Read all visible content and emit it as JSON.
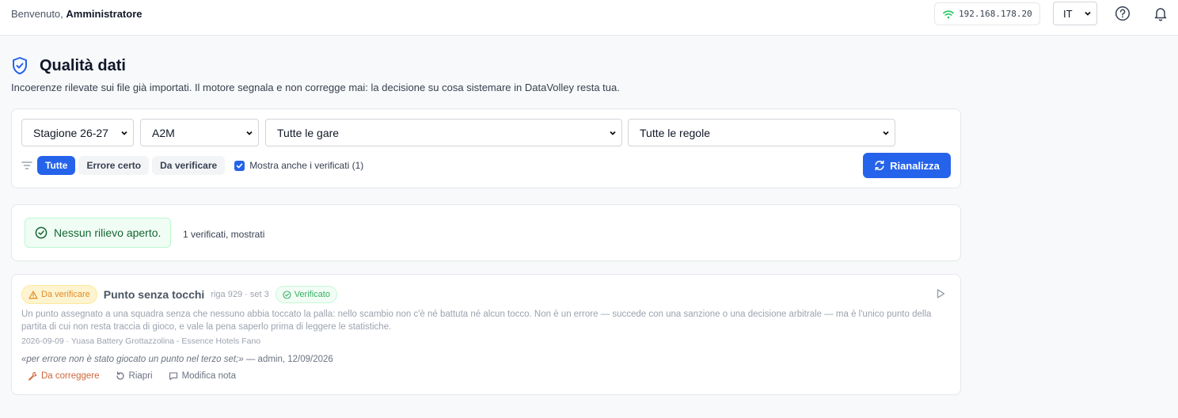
{
  "header": {
    "welcome_prefix": "Benvenuto,",
    "welcome_user": "Amministratore",
    "ip_address": "192.168.178.20",
    "language": "IT"
  },
  "page": {
    "title": "Qualità dati",
    "subtitle": "Incoerenze rilevate sui file già importati. Il motore segnala e non corregge mai: la decisione su cosa sistemare in DataVolley resta tua."
  },
  "filters": {
    "season": "Stagione 26-27",
    "league": "A2M",
    "matches": "Tutte le gare",
    "rules": "Tutte le regole",
    "pills": [
      "Tutte",
      "Errore certo",
      "Da verificare"
    ],
    "active_pill": "Tutte",
    "show_verified_label": "Mostra anche i verificati (1)",
    "show_verified_checked": true,
    "reanalyze_label": "Rianalizza"
  },
  "summary": {
    "badge": "Nessun rilievo aperto.",
    "note": "1 verificati, mostrati"
  },
  "issue": {
    "severity": "Da verificare",
    "title": "Punto senza tocchi",
    "meta": "riga 929 · set 3",
    "status": "Verificato",
    "description": "Un punto assegnato a una squadra senza che nessuno abbia toccato la palla: nello scambio non c'è né battuta né alcun tocco. Non è un errore — succede con una sanzione o una decisione arbitrale — ma è l'unico punto della partita di cui non resta traccia di gioco, e vale la pena saperlo prima di leggere le statistiche.",
    "match": "2026-09-09 · Yuasa Battery Grottazzolina - Essence Hotels Fano",
    "note_quote": "«per errore non è stato giocato un punto nel terzo set;»",
    "note_author": "— admin, 12/09/2026",
    "actions": {
      "fix": "Da correggere",
      "reopen": "Riapri",
      "edit_note": "Modifica nota"
    }
  },
  "colors": {
    "primary": "#2563eb",
    "success": "#16a34a",
    "warning": "#d97706",
    "wifi": "#22c55e"
  }
}
